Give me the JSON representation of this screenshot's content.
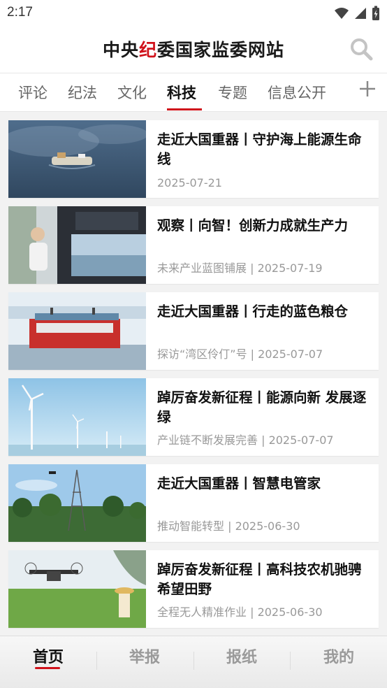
{
  "status_bar": {
    "time": "2:17"
  },
  "header": {
    "title_part1": "中央",
    "title_accent": "纪",
    "title_part2": "委国家监委网站"
  },
  "tabs": [
    {
      "label": "评论"
    },
    {
      "label": "纪法"
    },
    {
      "label": "文化"
    },
    {
      "label": "科技",
      "active": true
    },
    {
      "label": "专题"
    },
    {
      "label": "信息公开"
    }
  ],
  "articles": [
    {
      "title": "走近大国重器丨守护海上能源生命线",
      "meta": "2025-07-21"
    },
    {
      "title": "观察丨向智！创新力成就生产力",
      "meta": "未来产业蓝图铺展 | 2025-07-19"
    },
    {
      "title": "走近大国重器丨行走的蓝色粮仓",
      "meta": "探访“湾区伶仃”号 | 2025-07-07"
    },
    {
      "title": "踔厉奋发新征程丨能源向新 发展逐绿",
      "meta": "产业链不断发展完善 | 2025-07-07"
    },
    {
      "title": "走近大国重器丨智慧电管家",
      "meta": "推动智能转型 | 2025-06-30"
    },
    {
      "title": "踔厉奋发新征程丨高科技农机驰骋希望田野",
      "meta": "全程无人精准作业 | 2025-06-30"
    }
  ],
  "bottom_nav": [
    {
      "label": "首页",
      "active": true
    },
    {
      "label": "举报"
    },
    {
      "label": "报纸"
    },
    {
      "label": "我的"
    }
  ],
  "colors": {
    "accent": "#d0121b",
    "text": "#111111",
    "meta": "#999999"
  }
}
